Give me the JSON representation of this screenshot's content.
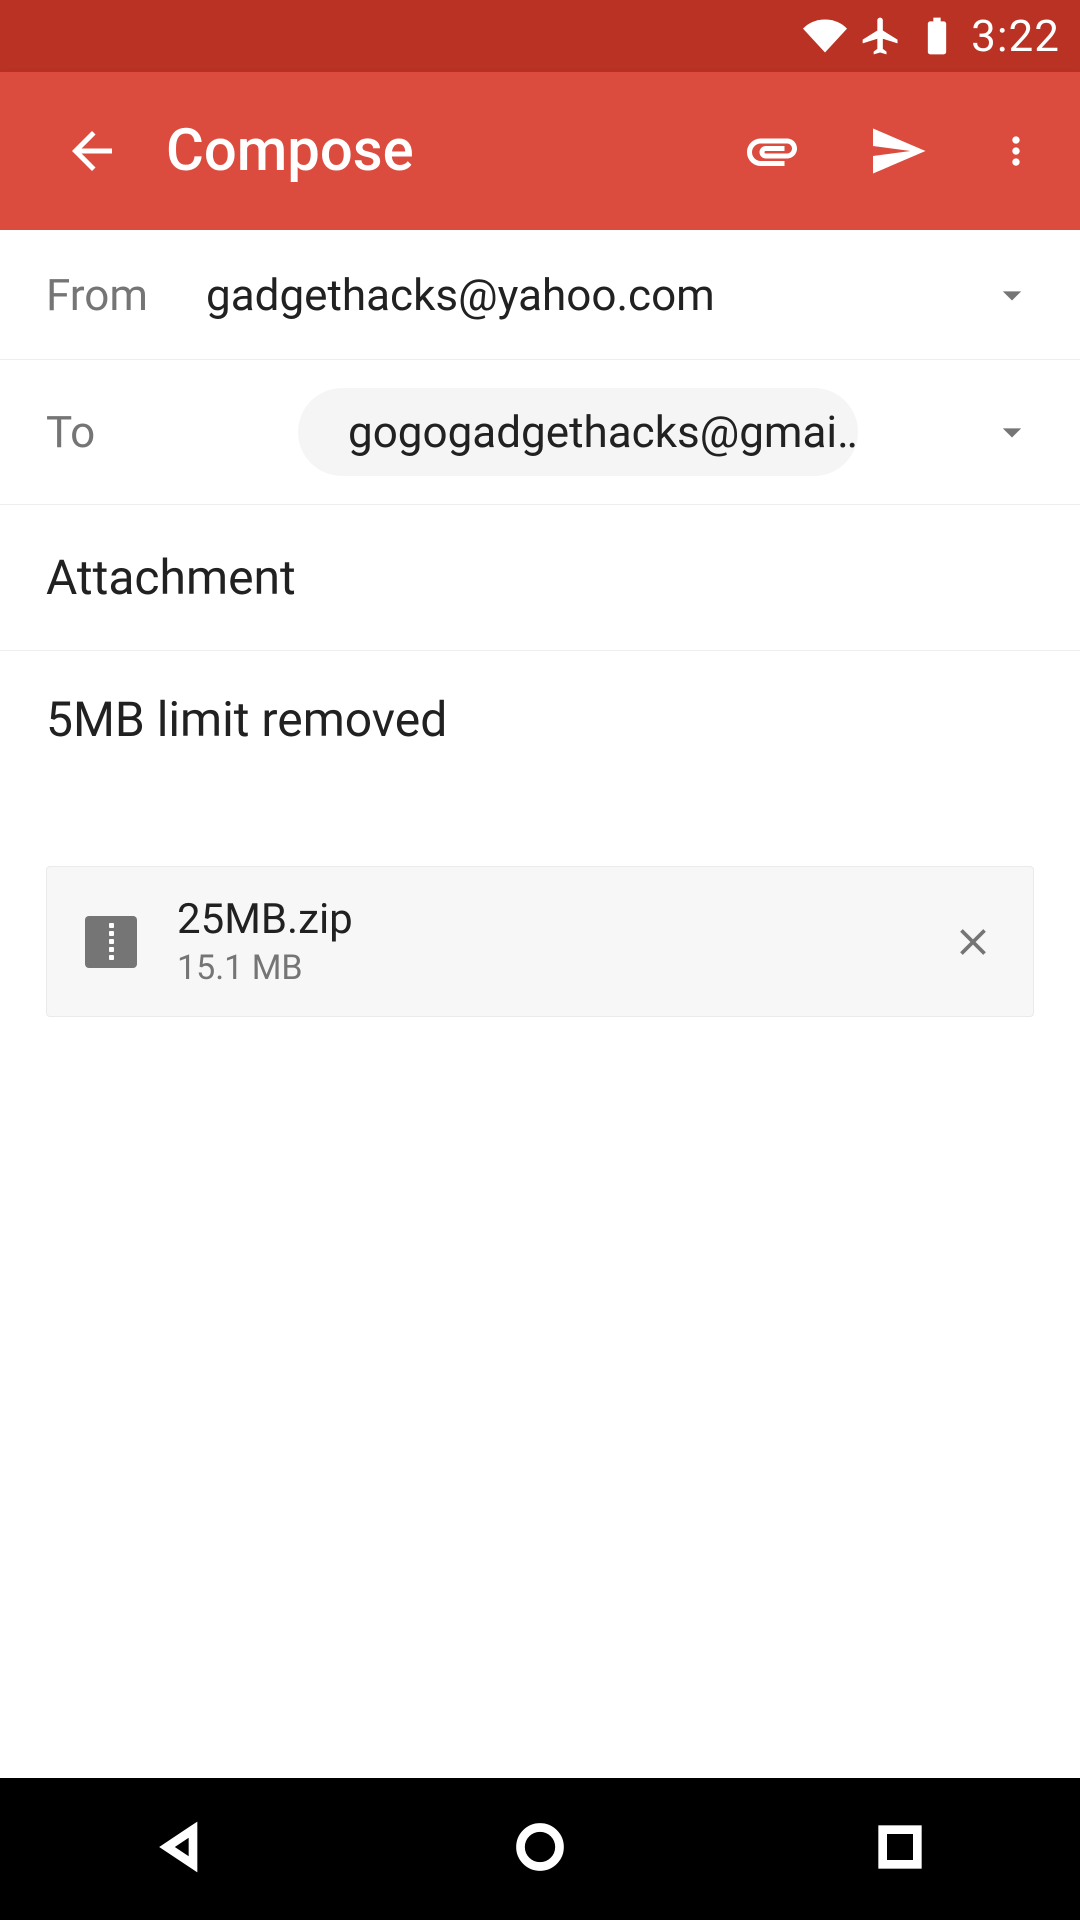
{
  "status": {
    "time": "3:22"
  },
  "appbar": {
    "title": "Compose"
  },
  "compose": {
    "from_label": "From",
    "from_value": "gadgethacks@yahoo.com",
    "to_label": "To",
    "to_value": "gogogadgethacks@gmai…",
    "subject": "Attachment",
    "body": "5MB limit removed"
  },
  "attachment": {
    "name": "25MB.zip",
    "size": "15.1 MB"
  }
}
